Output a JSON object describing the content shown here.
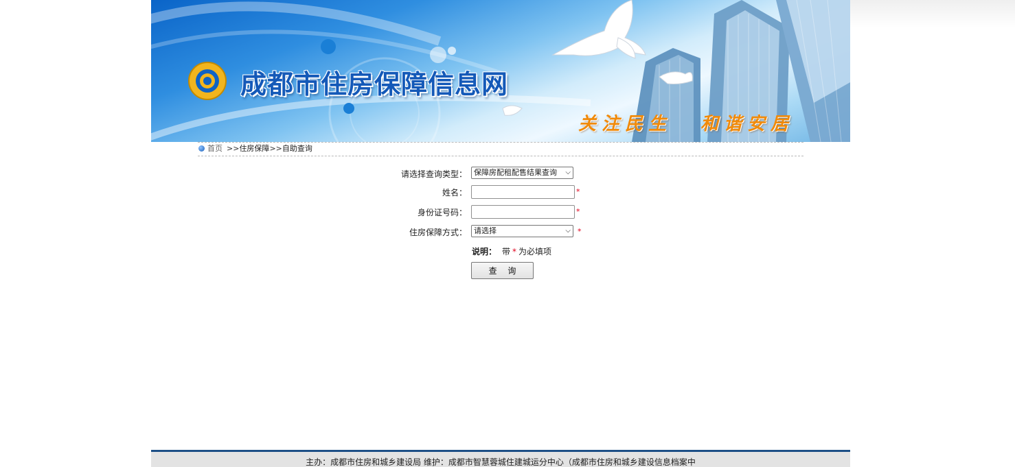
{
  "banner": {
    "title": "成都市住房保障信息网",
    "slogan_1": "关注民生",
    "slogan_2": "和谐安居",
    "colors": {
      "title": "#1459b8",
      "slogan": "#f08a0a",
      "logo": "#f2b51e"
    }
  },
  "breadcrumb": {
    "home": "首页",
    "separator_1": ">>",
    "item_1": "住房保障",
    "separator_2": ">>",
    "item_2": "自助查询"
  },
  "form": {
    "query_type": {
      "label": "请选择查询类型：",
      "value": "保障房配租配售结果查询"
    },
    "name": {
      "label": "姓名：",
      "value": ""
    },
    "id_number": {
      "label": "身份证号码：",
      "value": ""
    },
    "method": {
      "label": "住房保障方式：",
      "value": "请选择"
    },
    "required_mark": "*",
    "note_label": "说明：",
    "note_before": "带",
    "note_after": "为必填项",
    "submit_label": "查 询"
  },
  "footer": {
    "text": "主办：成都市住房和城乡建设局  维护：成都市智慧蓉城住建城运分中心（成都市住房和城乡建设信息档案中"
  },
  "icons": {
    "breadcrumb": "globe-bullet-icon",
    "select": "chevron-down-icon",
    "logo": "ring-logo-icon"
  }
}
